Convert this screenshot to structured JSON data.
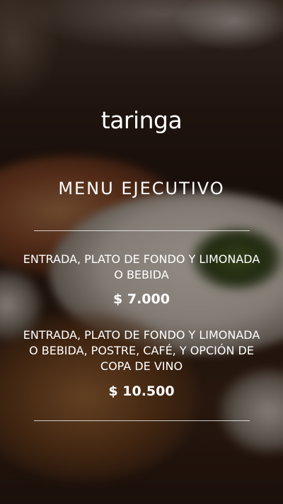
{
  "brand": {
    "logo_text": "taringa"
  },
  "menu": {
    "title": "MENU EJECUTIVO",
    "options": [
      {
        "description": "ENTRADA, PLATO DE FONDO Y LIMONADA O BEBIDA",
        "price": "$ 7.000"
      },
      {
        "description": "ENTRADA, PLATO DE FONDO Y LIMONADA O BEBIDA, POSTRE, CAFÉ, Y OPCIÓN DE COPA DE VINO",
        "price": "$ 10.500"
      }
    ]
  },
  "theme": {
    "text_color": "#ffffff",
    "overlay_color": "#1a0f0a"
  }
}
